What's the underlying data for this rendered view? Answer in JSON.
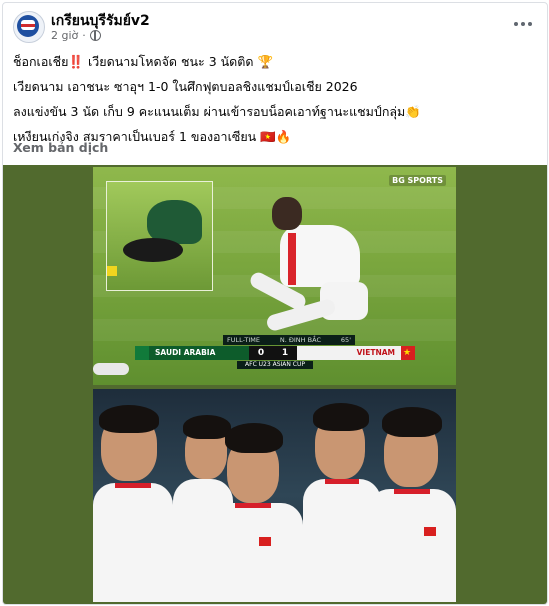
{
  "post": {
    "author": "เกรียนบุรีรัมย์v2",
    "time": "2 giờ",
    "separator": "·",
    "lines": [
      "ช็อกเอเชีย‼️ เวียดนามโหดจัด ชนะ 3 นัดติด 🏆",
      "เวียดนาม เอาชนะ ซาอุฯ 1-0 ในศึกฟุตบอลชิงแชมป์เอเชีย 2026",
      "ลงแข่งขัน 3 นัด เก็บ 9 คะแนนเต็ม ผ่านเข้ารอบน็อคเอาท์ฐานะแชมป์กลุ่ม👏",
      "เหงียนเก่งจิง สมราคาเป็นเบอร์ 1 ของอาเซียน 🇻🇳🔥"
    ],
    "see_translation": "Xem bản dịch"
  },
  "icons": {
    "more": "more-horizontal-icon",
    "privacy": "globe-icon"
  },
  "broadcast": {
    "channel": "BG SPORTS",
    "status": "FULL-TIME",
    "scorer": "N. ĐINH BẮC",
    "minute": "65'",
    "team_left": "SAUDI ARABIA",
    "score_left": "0",
    "score_right": "1",
    "team_right": "VIETNAM",
    "competition": "AFC U23 ASIAN CUP"
  },
  "colors": {
    "pitch": "#7aa63e",
    "media_bg": "#516a2e",
    "vietnam_red": "#d8201f",
    "saudi_green": "#0d5c2b",
    "meta_text": "#65676b"
  }
}
